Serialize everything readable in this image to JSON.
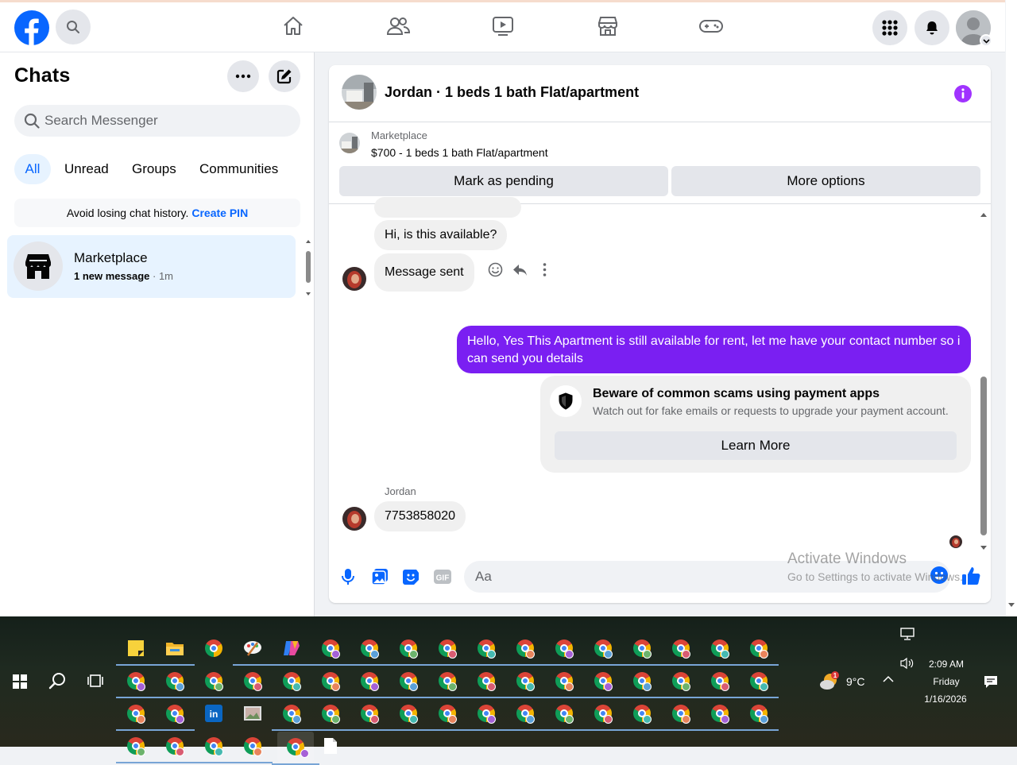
{
  "browser": {
    "brand_color": "#0866ff",
    "accent_purple": "#7a1ff2"
  },
  "sidebar": {
    "title": "Chats",
    "search_placeholder": "Search Messenger",
    "filters": [
      "All",
      "Unread",
      "Groups",
      "Communities"
    ],
    "pin_banner": {
      "text": "Avoid losing chat history.",
      "link": "Create PIN"
    },
    "chats": [
      {
        "name": "Marketplace",
        "status": "1 new message",
        "time": "· 1m"
      }
    ]
  },
  "conversation": {
    "title": "Jordan · 1 beds 1 bath Flat/apartment",
    "marketplace": {
      "label": "Marketplace",
      "listing": "$700 - 1 beds 1 bath Flat/apartment",
      "pending_button": "Mark as pending",
      "more_button": "More options"
    },
    "messages": [
      {
        "from": "Jordan",
        "text": "Hi, is this available?"
      },
      {
        "from": "Jordan",
        "text": "Message sent"
      },
      {
        "from": "me",
        "text": "Hello, Yes This Apartment is still available for rent, let me have your contact number so i can send you details"
      },
      {
        "from": "Jordan",
        "text": "7753858020"
      }
    ],
    "sender_name": "Jordan",
    "scam_notice": {
      "title": "Beware of common scams using payment apps",
      "text": "Watch out for fake emails or requests to upgrade your payment account.",
      "button": "Learn More"
    },
    "composer_placeholder": "Aa"
  },
  "watermark": {
    "title": "Activate Windows",
    "subtitle": "Go to Settings to activate Windows."
  },
  "taskbar": {
    "weather": "9°C",
    "weather_badge": "1",
    "time": "2:09 AM",
    "day": "Friday",
    "date": "1/16/2026",
    "pinned_apps": [
      "sticky-notes",
      "file-explorer",
      "chrome",
      "paint",
      "copilot",
      "linkedin",
      "image-viewer",
      "notepad"
    ],
    "chrome_profile_colors": [
      "#e8845c",
      "#a561d6",
      "#5aa0d8",
      "#6cb36c",
      "#d95c72",
      "#45b9b0"
    ]
  }
}
